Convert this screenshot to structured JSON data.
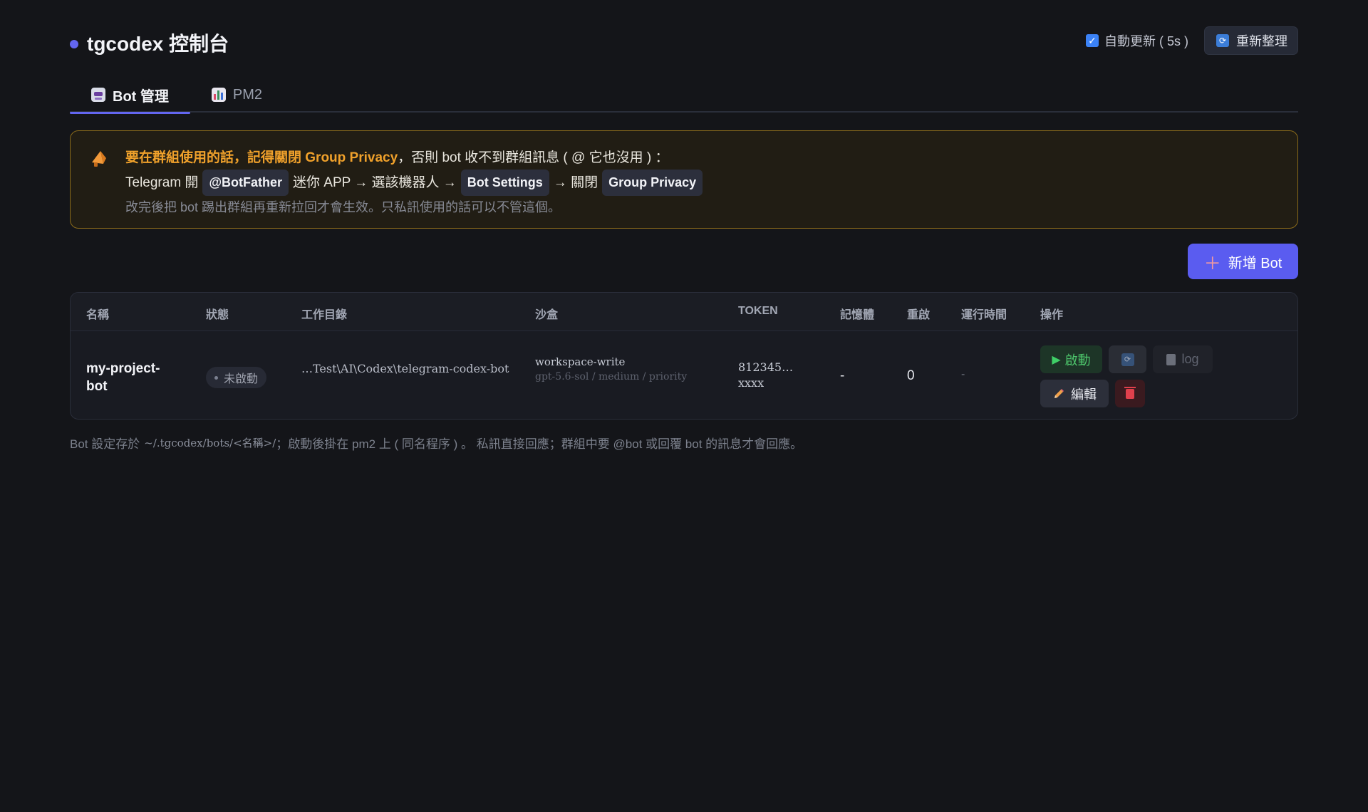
{
  "header": {
    "title": "tgcodex 控制台",
    "auto_refresh_label": "自動更新 ( 5s )",
    "auto_refresh_checked": true,
    "refresh_button": "重新整理"
  },
  "tabs": [
    {
      "label": "Bot 管理",
      "icon": "robot-icon",
      "active": true
    },
    {
      "label": "PM2",
      "icon": "bar-chart-icon",
      "active": false
    }
  ],
  "notice": {
    "icon": "megaphone-icon",
    "line1_highlight": "要在群組使用的話，記得關閉 Group Privacy",
    "line1_rest": "，否則 bot 收不到群組訊息 ( @ 它也沒用 ) ：",
    "line2_prefix": "Telegram 開",
    "line2_chip1": "@BotFather",
    "line2_mid": "迷你 APP → 選該機器人 →",
    "line2_chip2": "Bot Settings",
    "line2_mid2": "→ 關閉",
    "line2_chip3": "Group Privacy",
    "line3": "改完後把 bot 踢出群組再重新拉回才會生效。只私訊使用的話可以不管這個。"
  },
  "add_button": "新增 Bot",
  "table": {
    "columns": [
      "名稱",
      "狀態",
      "工作目錄",
      "沙盒",
      "TOKEN",
      "記憶體",
      "重啟",
      "運行時間",
      "操作"
    ],
    "rows": [
      {
        "name": "my-project-bot",
        "status": "未啟動",
        "workdir": "…Test\\AI\\Codex\\telegram-codex-bot",
        "sandbox": "workspace-write",
        "sandbox_sub": "gpt-5.6-sol / medium / priority",
        "token": "812345…xxxx",
        "memory": "-",
        "restarts": "0",
        "uptime": "-",
        "actions": {
          "start": "啟動",
          "log": "log",
          "edit": "編輯"
        }
      }
    ]
  },
  "footer": {
    "prefix": "Bot 設定存於",
    "path": "~/.tgcodex/bots/<名稱>/",
    "suffix": "；啟動後掛在 pm2 上 ( 同名程序 ) 。 私訊直接回應；群組中要 @bot 或回覆 bot 的訊息才會回應。"
  },
  "colors": {
    "accent": "#6366f1",
    "warning_border": "#8a6a1a",
    "warning_text": "#f0a12b",
    "start_green": "#4cc26a",
    "danger_red": "#e0404c"
  }
}
